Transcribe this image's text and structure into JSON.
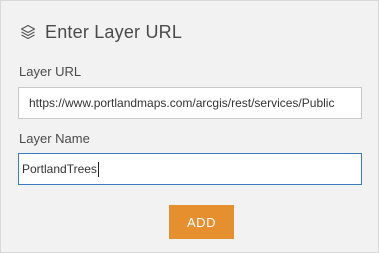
{
  "header": {
    "title": "Enter Layer URL",
    "icon": "layers-icon"
  },
  "layer_url": {
    "label": "Layer URL",
    "value": "https://www.portlandmaps.com/arcgis/rest/services/Public"
  },
  "layer_name": {
    "label": "Layer Name",
    "value": "PortlandTrees"
  },
  "actions": {
    "add_label": "ADD"
  },
  "colors": {
    "accent": "#e58f2e",
    "focus_border": "#3b7bbf",
    "panel_bg": "#f2f2f2"
  }
}
